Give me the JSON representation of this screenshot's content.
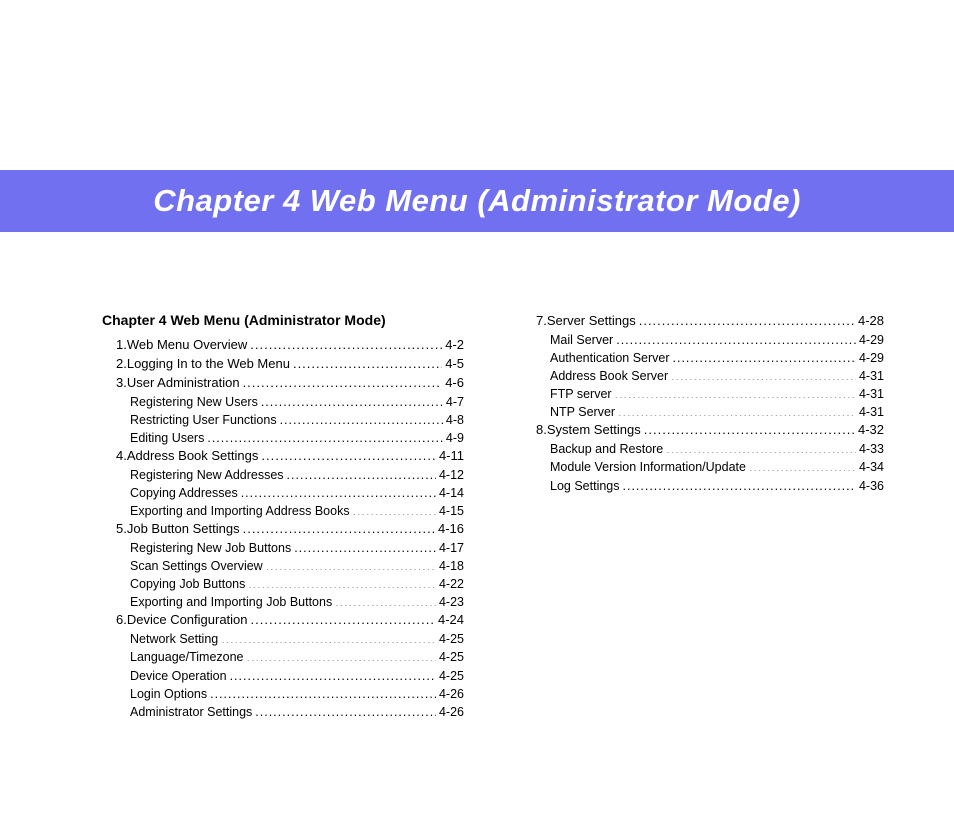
{
  "banner": {
    "title": "Chapter 4   Web Menu (Administrator Mode)"
  },
  "toc": {
    "header": "Chapter 4   Web Menu (Administrator Mode)",
    "left": [
      {
        "type": "section",
        "num": "1.",
        "label": "Web Menu Overview",
        "page": "4-2"
      },
      {
        "type": "section",
        "num": "2.",
        "label": "Logging In to the Web Menu",
        "page": "4-5"
      },
      {
        "type": "section",
        "num": "3.",
        "label": "User Administration",
        "page": "4-6"
      },
      {
        "type": "sub",
        "label": "Registering New Users",
        "page": "4-7"
      },
      {
        "type": "sub",
        "label": "Restricting User Functions",
        "page": "4-8"
      },
      {
        "type": "sub",
        "label": "Editing Users",
        "page": "4-9"
      },
      {
        "type": "section",
        "num": "4.",
        "label": "Address Book Settings",
        "page": "4-11"
      },
      {
        "type": "sub",
        "label": "Registering New Addresses",
        "page": "4-12"
      },
      {
        "type": "sub",
        "label": "Copying Addresses",
        "page": "4-14"
      },
      {
        "type": "sub",
        "label": "Exporting and Importing Address Books",
        "page": "4-15"
      },
      {
        "type": "section",
        "num": "5.",
        "label": "Job Button Settings",
        "page": "4-16"
      },
      {
        "type": "sub",
        "label": "Registering New Job Buttons",
        "page": "4-17"
      },
      {
        "type": "sub",
        "label": "Scan Settings Overview",
        "page": "4-18"
      },
      {
        "type": "sub",
        "label": "Copying Job Buttons",
        "page": "4-22"
      },
      {
        "type": "sub",
        "label": "Exporting and Importing Job Buttons",
        "page": "4-23"
      },
      {
        "type": "section",
        "num": "6.",
        "label": "Device Configuration",
        "page": "4-24"
      },
      {
        "type": "sub",
        "label": "Network Setting",
        "page": "4-25"
      },
      {
        "type": "sub",
        "label": "Language/Timezone",
        "page": "4-25"
      },
      {
        "type": "sub",
        "label": "Device Operation",
        "page": "4-25"
      },
      {
        "type": "sub",
        "label": "Login Options",
        "page": "4-26"
      },
      {
        "type": "sub",
        "label": "Administrator Settings",
        "page": "4-26"
      }
    ],
    "right": [
      {
        "type": "section",
        "num": "7.",
        "label": "Server Settings",
        "page": "4-28"
      },
      {
        "type": "sub",
        "label": "Mail Server",
        "page": "4-29"
      },
      {
        "type": "sub",
        "label": "Authentication Server",
        "page": "4-29"
      },
      {
        "type": "sub",
        "label": "Address Book Server",
        "page": "4-31"
      },
      {
        "type": "sub",
        "label": "FTP server",
        "page": "4-31"
      },
      {
        "type": "sub",
        "label": "NTP Server",
        "page": "4-31"
      },
      {
        "type": "section",
        "num": "8.",
        "label": "System Settings",
        "page": "4-32"
      },
      {
        "type": "sub",
        "label": "Backup and Restore",
        "page": "4-33"
      },
      {
        "type": "sub",
        "label": "Module Version Information/Update",
        "page": "4-34"
      },
      {
        "type": "sub",
        "label": "Log Settings",
        "page": "4-36"
      }
    ]
  }
}
